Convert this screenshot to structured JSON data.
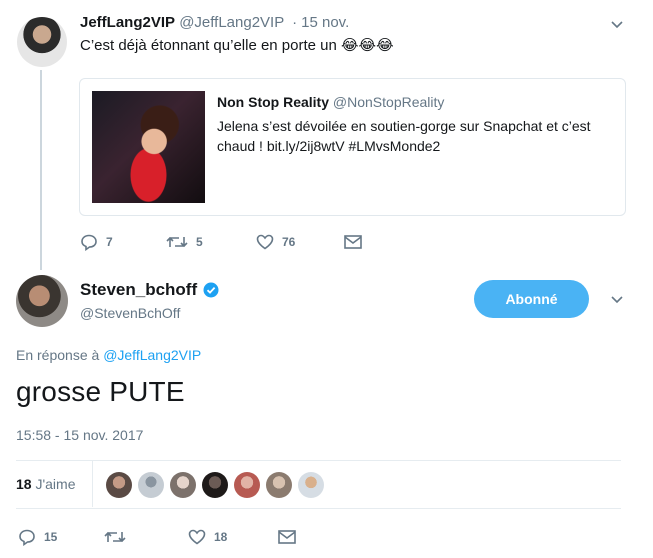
{
  "tweet1": {
    "display_name": "JeffLang2VIP",
    "handle": "@JeffLang2VIP",
    "separator": "·",
    "date": "15 nov.",
    "text": "C’est déjà étonnant qu’elle en porte un",
    "emojis": "😂😂😂",
    "quote": {
      "display_name": "Non Stop Reality",
      "handle": "@NonStopReality",
      "text": "Jelena s’est dévoilée en soutien-gorge sur Snapchat et c’est chaud ! bit.ly/2ij8wtV #LMvsMonde2"
    },
    "actions": {
      "replies": "7",
      "retweets": "5",
      "likes": "76"
    }
  },
  "tweet2": {
    "display_name": "Steven_bchoff",
    "handle": "@StevenBchOff",
    "follow_label": "Abonné",
    "reply_prefix": "En réponse à",
    "reply_to": "@JeffLang2VIP",
    "text": "grosse PUTE",
    "timestamp": "15:58 - 15 nov. 2017",
    "likes_count": "18",
    "likes_label": "J'aime",
    "actions": {
      "replies": "15",
      "retweets": "",
      "likes": "18"
    }
  },
  "colors": {
    "accent": "#1da1f2",
    "follow_button": "#4ab3f4",
    "muted_text": "#657786",
    "border": "#e1e8ed"
  },
  "icons": [
    "reply-icon",
    "retweet-icon",
    "heart-icon",
    "mail-icon",
    "chevron-down-icon",
    "verified-badge-icon"
  ]
}
